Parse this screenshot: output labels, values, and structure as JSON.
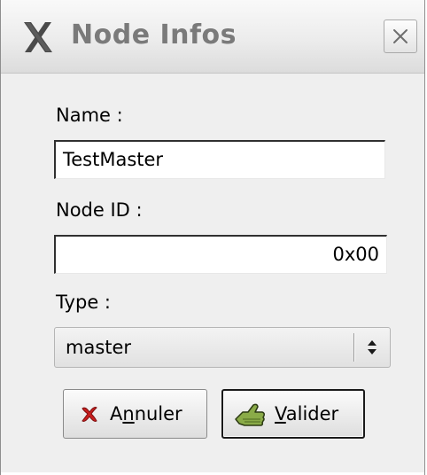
{
  "window": {
    "title": "Node Infos",
    "app_icon": "x-logo-icon",
    "close_icon": "close-icon"
  },
  "form": {
    "name_label": "Name :",
    "name_value": "TestMaster",
    "node_id_label": "Node ID :",
    "node_id_value": "0x00",
    "type_label": "Type :",
    "type_value": "master"
  },
  "buttons": {
    "cancel": {
      "label_pre": "A",
      "label_mnemonic": "n",
      "label_post": "nuler",
      "icon": "cancel-x-icon"
    },
    "ok": {
      "label_pre": "",
      "label_mnemonic": "V",
      "label_post": "alider",
      "icon": "apply-hand-icon"
    }
  },
  "colors": {
    "window_bg": "#efefef",
    "title_text": "#7a7a7a",
    "cancel_icon": "#c81e1e",
    "ok_icon": "#7a9a3c"
  }
}
